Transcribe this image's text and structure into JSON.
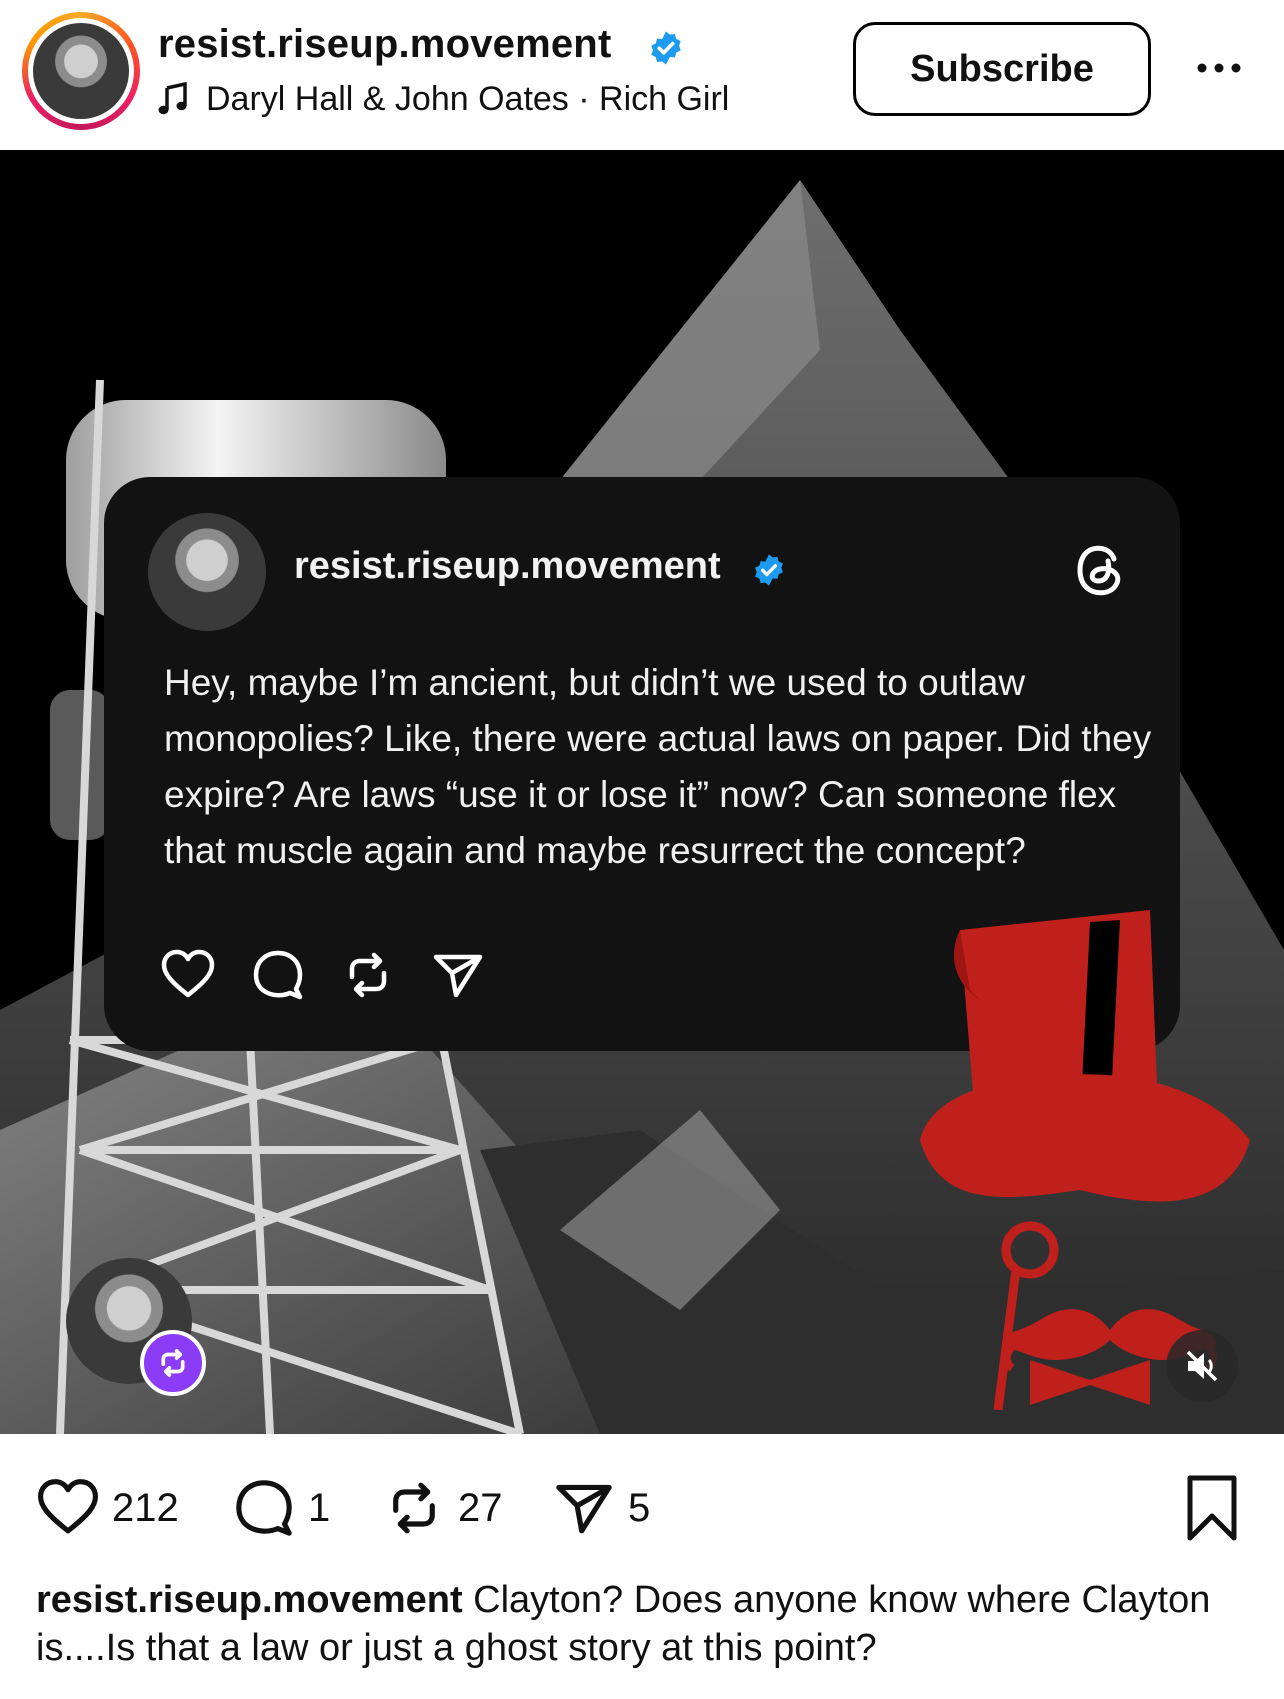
{
  "header": {
    "username": "resist.riseup.movement",
    "verified": true,
    "audio": "Daryl Hall & John Oates · Rich Girl",
    "subscribe_label": "Subscribe"
  },
  "media": {
    "card": {
      "username": "resist.riseup.movement",
      "text": "Hey, maybe I’m ancient, but didn’t we used to outlaw monopolies? Like, there were actual laws on paper. Did they expire? Are laws “use it or lose it” now? Can someone flex that muscle again and maybe resurrect the concept?",
      "brand_icon": "threads-icon"
    },
    "hat_color": "#c0201b",
    "repost_badge_color": "#8b3cf7"
  },
  "actions": {
    "likes": "212",
    "comments": "1",
    "reposts": "27",
    "shares": "5"
  },
  "caption": {
    "username": "resist.riseup.movement",
    "text": " Clayton? Does anyone know where Clayton is....Is that a law or just a ghost story at this point?"
  },
  "colors": {
    "verified": "#1d9bf0",
    "card_bg": "#121212"
  }
}
